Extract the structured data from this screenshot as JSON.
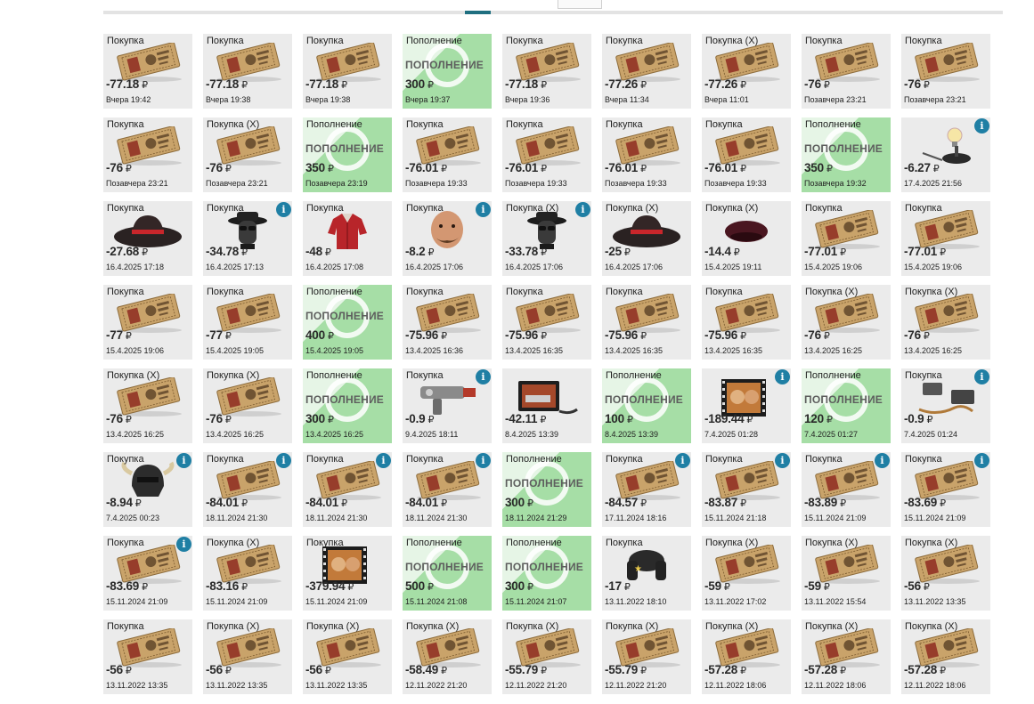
{
  "currency": "₽",
  "info_glyph": "i",
  "topup_label": "ПОПОЛНЕНИЕ",
  "cards": [
    {
      "type": "Покупка",
      "amount": "-77.18",
      "date": "Вчера 19:42",
      "icon": "ticket-icon",
      "info": false
    },
    {
      "type": "Покупка",
      "amount": "-77.18",
      "date": "Вчера 19:38",
      "icon": "ticket-icon",
      "info": false
    },
    {
      "type": "Покупка",
      "amount": "-77.18",
      "date": "Вчера 19:38",
      "icon": "ticket-icon",
      "info": false
    },
    {
      "type": "Пополнение",
      "amount": "300",
      "date": "Вчера 19:37",
      "icon": "topup-icon",
      "info": false
    },
    {
      "type": "Покупка",
      "amount": "-77.18",
      "date": "Вчера 19:36",
      "icon": "ticket-icon",
      "info": false
    },
    {
      "type": "Покупка",
      "amount": "-77.26",
      "date": "Вчера 11:34",
      "icon": "ticket-icon",
      "info": false
    },
    {
      "type": "Покупка (X)",
      "amount": "-77.26",
      "date": "Вчера 11:01",
      "icon": "ticket-icon",
      "info": false
    },
    {
      "type": "Покупка",
      "amount": "-76",
      "date": "Позавчера 23:21",
      "icon": "ticket-icon",
      "info": false
    },
    {
      "type": "Покупка",
      "amount": "-76",
      "date": "Позавчера 23:21",
      "icon": "ticket-icon",
      "info": false
    },
    {
      "type": "Покупка",
      "amount": "-76",
      "date": "Позавчера 23:21",
      "icon": "ticket-icon",
      "info": false
    },
    {
      "type": "Покупка (X)",
      "amount": "-76",
      "date": "Позавчера 23:21",
      "icon": "ticket-icon",
      "info": false
    },
    {
      "type": "Пополнение",
      "amount": "350",
      "date": "Позавчера 23:19",
      "icon": "topup-icon",
      "info": false
    },
    {
      "type": "Покупка",
      "amount": "-76.01",
      "date": "Позавчера 19:33",
      "icon": "ticket-icon",
      "info": false
    },
    {
      "type": "Покупка",
      "amount": "-76.01",
      "date": "Позавчера 19:33",
      "icon": "ticket-icon",
      "info": false
    },
    {
      "type": "Покупка",
      "amount": "-76.01",
      "date": "Позавчера 19:33",
      "icon": "ticket-icon",
      "info": false
    },
    {
      "type": "Покупка",
      "amount": "-76.01",
      "date": "Позавчера 19:33",
      "icon": "ticket-icon",
      "info": false
    },
    {
      "type": "Пополнение",
      "amount": "350",
      "date": "Позавчера 19:32",
      "icon": "topup-icon",
      "info": false
    },
    {
      "type": "",
      "amount": "-6.27",
      "date": "17.4.2025 21:56",
      "icon": "lamp-icon",
      "info": true
    },
    {
      "type": "Покупка",
      "amount": "-27.68",
      "date": "16.4.2025 17:18",
      "icon": "hat-icon",
      "info": false
    },
    {
      "type": "Покупка",
      "amount": "-34.78",
      "date": "16.4.2025 17:13",
      "icon": "spy-mask-icon",
      "info": true
    },
    {
      "type": "Покупка",
      "amount": "-48",
      "date": "16.4.2025 17:08",
      "icon": "shirt-icon",
      "info": false
    },
    {
      "type": "Покупка",
      "amount": "-8.2",
      "date": "16.4.2025 17:06",
      "icon": "head-icon",
      "info": true
    },
    {
      "type": "Покупка (X)",
      "amount": "-33.78",
      "date": "16.4.2025 17:06",
      "icon": "spy-mask-icon",
      "info": true
    },
    {
      "type": "Покупка (X)",
      "amount": "-25",
      "date": "16.4.2025 17:06",
      "icon": "hat-icon",
      "info": false
    },
    {
      "type": "Покупка (X)",
      "amount": "-14.4",
      "date": "15.4.2025 19:11",
      "icon": "beret-icon",
      "info": false
    },
    {
      "type": "Покупка",
      "amount": "-77.01",
      "date": "15.4.2025 19:06",
      "icon": "ticket-icon",
      "info": false
    },
    {
      "type": "Покупка",
      "amount": "-77.01",
      "date": "15.4.2025 19:06",
      "icon": "ticket-icon",
      "info": false
    },
    {
      "type": "Покупка",
      "amount": "-77",
      "date": "15.4.2025 19:06",
      "icon": "ticket-icon",
      "info": false
    },
    {
      "type": "Покупка",
      "amount": "-77",
      "date": "15.4.2025 19:05",
      "icon": "ticket-icon",
      "info": false
    },
    {
      "type": "Пополнение",
      "amount": "400",
      "date": "15.4.2025 19:05",
      "icon": "topup-icon",
      "info": false
    },
    {
      "type": "Покупка",
      "amount": "-75.96",
      "date": "13.4.2025 16:36",
      "icon": "ticket-icon",
      "info": false
    },
    {
      "type": "Покупка",
      "amount": "-75.96",
      "date": "13.4.2025 16:35",
      "icon": "ticket-icon",
      "info": false
    },
    {
      "type": "Покупка",
      "amount": "-75.96",
      "date": "13.4.2025 16:35",
      "icon": "ticket-icon",
      "info": false
    },
    {
      "type": "Покупка",
      "amount": "-75.96",
      "date": "13.4.2025 16:35",
      "icon": "ticket-icon",
      "info": false
    },
    {
      "type": "Покупка (X)",
      "amount": "-76",
      "date": "13.4.2025 16:25",
      "icon": "ticket-icon",
      "info": false
    },
    {
      "type": "Покупка (X)",
      "amount": "-76",
      "date": "13.4.2025 16:25",
      "icon": "ticket-icon",
      "info": false
    },
    {
      "type": "Покупка (X)",
      "amount": "-76",
      "date": "13.4.2025 16:25",
      "icon": "ticket-icon",
      "info": false
    },
    {
      "type": "Покупка (X)",
      "amount": "-76",
      "date": "13.4.2025 16:25",
      "icon": "ticket-icon",
      "info": false
    },
    {
      "type": "Пополнение",
      "amount": "300",
      "date": "13.4.2025 16:25",
      "icon": "topup-icon",
      "info": false
    },
    {
      "type": "Покупка",
      "amount": "-0.9",
      "date": "9.4.2025 18:11",
      "icon": "raygun-icon",
      "info": true
    },
    {
      "type": "",
      "amount": "-42.11",
      "date": "8.4.2025 13:39",
      "icon": "monitor-icon",
      "info": false
    },
    {
      "type": "Пополнение",
      "amount": "100",
      "date": "8.4.2025 13:39",
      "icon": "topup-icon",
      "info": false
    },
    {
      "type": "",
      "amount": "-189.44",
      "date": "7.4.2025 01:28",
      "icon": "film-icon",
      "info": true
    },
    {
      "type": "Пополнение",
      "amount": "120",
      "date": "7.4.2025 01:27",
      "icon": "topup-icon",
      "info": false
    },
    {
      "type": "Покупка",
      "amount": "-0.9",
      "date": "7.4.2025 01:24",
      "icon": "device-icon",
      "info": true
    },
    {
      "type": "Покупка",
      "amount": "-8.94",
      "date": "7.4.2025 00:23",
      "icon": "helmet-icon",
      "info": true
    },
    {
      "type": "Покупка",
      "amount": "-84.01",
      "date": "18.11.2024 21:30",
      "icon": "ticket-icon",
      "info": true
    },
    {
      "type": "Покупка",
      "amount": "-84.01",
      "date": "18.11.2024 21:30",
      "icon": "ticket-icon",
      "info": true
    },
    {
      "type": "Покупка",
      "amount": "-84.01",
      "date": "18.11.2024 21:30",
      "icon": "ticket-icon",
      "info": true
    },
    {
      "type": "Пополнение",
      "amount": "300",
      "date": "18.11.2024 21:29",
      "icon": "topup-icon",
      "info": false
    },
    {
      "type": "Покупка",
      "amount": "-84.57",
      "date": "17.11.2024 18:16",
      "icon": "ticket-icon",
      "info": true
    },
    {
      "type": "Покупка",
      "amount": "-83.87",
      "date": "15.11.2024 21:18",
      "icon": "ticket-icon",
      "info": true
    },
    {
      "type": "Покупка",
      "amount": "-83.89",
      "date": "15.11.2024 21:09",
      "icon": "ticket-icon",
      "info": true
    },
    {
      "type": "Покупка",
      "amount": "-83.69",
      "date": "15.11.2024 21:09",
      "icon": "ticket-icon",
      "info": true
    },
    {
      "type": "Покупка",
      "amount": "-83.69",
      "date": "15.11.2024 21:09",
      "icon": "ticket-icon",
      "info": true
    },
    {
      "type": "Покупка (X)",
      "amount": "-83.16",
      "date": "15.11.2024 21:09",
      "icon": "ticket-icon",
      "info": false
    },
    {
      "type": "Покупка",
      "amount": "-379.94",
      "date": "15.11.2024 21:09",
      "icon": "film-icon",
      "info": false
    },
    {
      "type": "Пополнение",
      "amount": "500",
      "date": "15.11.2024 21:08",
      "icon": "topup-icon",
      "info": false
    },
    {
      "type": "Пополнение",
      "amount": "300",
      "date": "15.11.2024 21:07",
      "icon": "topup-icon",
      "info": false
    },
    {
      "type": "Покупка",
      "amount": "-17",
      "date": "13.11.2022 18:10",
      "icon": "ushanka-icon",
      "info": false
    },
    {
      "type": "Покупка (X)",
      "amount": "-59",
      "date": "13.11.2022 17:02",
      "icon": "ticket-icon",
      "info": false
    },
    {
      "type": "Покупка (X)",
      "amount": "-59",
      "date": "13.11.2022 15:54",
      "icon": "ticket-icon",
      "info": false
    },
    {
      "type": "Покупка (X)",
      "amount": "-56",
      "date": "13.11.2022 13:35",
      "icon": "ticket-icon",
      "info": false
    },
    {
      "type": "Покупка",
      "amount": "-56",
      "date": "13.11.2022 13:35",
      "icon": "ticket-icon",
      "info": false
    },
    {
      "type": "Покупка (X)",
      "amount": "-56",
      "date": "13.11.2022 13:35",
      "icon": "ticket-icon",
      "info": false
    },
    {
      "type": "Покупка (X)",
      "amount": "-56",
      "date": "13.11.2022 13:35",
      "icon": "ticket-icon",
      "info": false
    },
    {
      "type": "Покупка (X)",
      "amount": "-58.49",
      "date": "12.11.2022 21:20",
      "icon": "ticket-icon",
      "info": false
    },
    {
      "type": "Покупка (X)",
      "amount": "-55.79",
      "date": "12.11.2022 21:20",
      "icon": "ticket-icon",
      "info": false
    },
    {
      "type": "Покупка (X)",
      "amount": "-55.79",
      "date": "12.11.2022 21:20",
      "icon": "ticket-icon",
      "info": false
    },
    {
      "type": "Покупка (X)",
      "amount": "-57.28",
      "date": "12.11.2022 18:06",
      "icon": "ticket-icon",
      "info": false
    },
    {
      "type": "Покупка (X)",
      "amount": "-57.28",
      "date": "12.11.2022 18:06",
      "icon": "ticket-icon",
      "info": false
    },
    {
      "type": "Покупка (X)",
      "amount": "-57.28",
      "date": "12.11.2022 18:06",
      "icon": "ticket-icon",
      "info": false
    }
  ]
}
